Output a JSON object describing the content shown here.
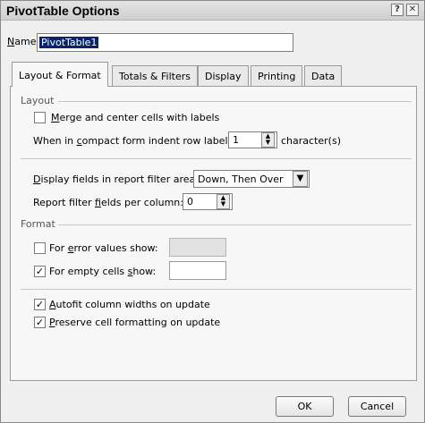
{
  "window": {
    "title": "PivotTable Options",
    "help_glyph": "?",
    "close_glyph": "✕"
  },
  "name_field": {
    "label_prefix": "",
    "label_mnemonic": "N",
    "label_rest": "ame:",
    "value": "PivotTable1"
  },
  "tabs": [
    {
      "label": "Layout & Format",
      "active": true
    },
    {
      "label": "Totals & Filters",
      "active": false
    },
    {
      "label": "Display",
      "active": false
    },
    {
      "label": "Printing",
      "active": false
    },
    {
      "label": "Data",
      "active": false
    }
  ],
  "layout_section": {
    "heading": "Layout",
    "merge_cells": {
      "label_mnemonic": "M",
      "label_rest": "erge and center cells with labels",
      "checked": false
    },
    "indent": {
      "label_prefix": "When in ",
      "label_mnemonic": "c",
      "label_rest": "ompact form indent row labels:",
      "value": "1",
      "suffix": "character(s)"
    },
    "filter_area": {
      "label_mnemonic": "D",
      "label_rest": "isplay fields in report filter area:",
      "value": "Down, Then Over"
    },
    "fields_per_column": {
      "label_prefix": "Report filter ",
      "label_mnemonic": "f",
      "label_rest": "ields per column:",
      "value": "0"
    }
  },
  "format_section": {
    "heading": "Format",
    "error_values": {
      "label_prefix": "For ",
      "label_mnemonic": "e",
      "label_rest": "rror values show:",
      "checked": false,
      "value": ""
    },
    "empty_cells": {
      "label_prefix": "For empty cells ",
      "label_mnemonic": "s",
      "label_rest": "how:",
      "checked": true,
      "value": ""
    },
    "autofit": {
      "label_mnemonic": "A",
      "label_rest": "utofit column widths on update",
      "checked": true
    },
    "preserve": {
      "label_mnemonic": "P",
      "label_rest": "reserve cell formatting on update",
      "checked": true
    }
  },
  "buttons": {
    "ok": "OK",
    "cancel": "Cancel"
  },
  "glyphs": {
    "check": "✓",
    "spin_up": "▲",
    "spin_down": "▼",
    "dropdown": "▼"
  }
}
